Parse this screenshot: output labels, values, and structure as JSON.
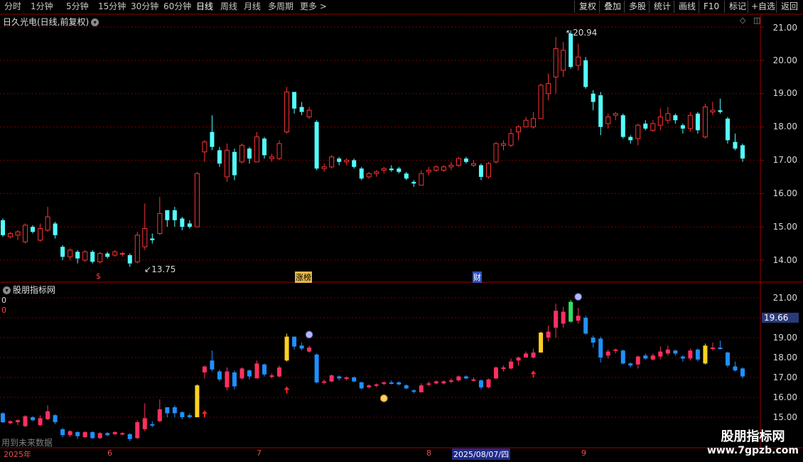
{
  "toolbar": {
    "periods": [
      "分时",
      "1分钟",
      "5分钟",
      "15分钟",
      "30分钟",
      "60分钟",
      "日线",
      "周线",
      "月线",
      "多周期",
      "更多 >"
    ],
    "active_period": "日线",
    "actions": [
      "复权",
      "叠加",
      "多股",
      "统计",
      "画线",
      "F10",
      "+自选",
      "返回"
    ],
    "mark_label": "标记"
  },
  "main_panel": {
    "title": "日久光电(日线,前复权)",
    "high_label": "20.94",
    "low_label": "13.75",
    "markers": [
      "$",
      "涨榜",
      "财"
    ],
    "y_ticks": [
      "21.00",
      "20.00",
      "19.00",
      "18.00",
      "17.00",
      "16.00",
      "15.00",
      "14.00"
    ]
  },
  "indicator_panel": {
    "title": "股朋指标网",
    "left_values": [
      "0",
      "0"
    ],
    "current_value": "19.66",
    "y_ticks": [
      "21.00",
      "19.00",
      "18.00",
      "17.00",
      "16.00",
      "15.00"
    ],
    "footer_note": "用到未来数据"
  },
  "time_axis": {
    "labels": [
      "2025年",
      "6",
      "7",
      "8",
      "9"
    ],
    "cursor_date": "2025/08/07/四"
  },
  "watermark": {
    "title": "股朋指标网",
    "url": "www.7gpzb.com"
  },
  "colors": {
    "up": "#ff3232",
    "down": "#54ffff",
    "bg": "#000000",
    "grid": "#7a0000"
  },
  "chart_data": {
    "type": "candlestick",
    "title": "日久光电(日线,前复权)",
    "ylim": [
      13.6,
      21.3
    ],
    "candles": [
      [
        15.2,
        14.75,
        15.25,
        14.7
      ],
      [
        14.7,
        14.8,
        14.85,
        14.65
      ],
      [
        14.75,
        14.85,
        14.9,
        14.6
      ],
      [
        14.55,
        15.05,
        15.1,
        14.5
      ],
      [
        15.0,
        14.85,
        15.05,
        14.8
      ],
      [
        14.6,
        14.95,
        15.1,
        14.55
      ],
      [
        14.9,
        15.3,
        15.6,
        14.85
      ],
      [
        15.1,
        14.75,
        15.15,
        14.65
      ],
      [
        14.4,
        14.1,
        14.45,
        14.0
      ],
      [
        14.1,
        14.3,
        14.35,
        14.0
      ],
      [
        14.25,
        14.05,
        14.3,
        13.9
      ],
      [
        14.0,
        14.25,
        14.3,
        13.95
      ],
      [
        14.25,
        13.95,
        14.3,
        13.9
      ],
      [
        13.95,
        14.2,
        14.25,
        13.9
      ],
      [
        14.2,
        14.1,
        14.25,
        14.05
      ],
      [
        14.15,
        14.25,
        14.3,
        14.1
      ],
      [
        14.2,
        14.2,
        14.25,
        14.1
      ],
      [
        14.15,
        13.9,
        14.2,
        13.8
      ],
      [
        13.95,
        14.75,
        14.85,
        13.9
      ],
      [
        14.4,
        14.95,
        15.7,
        14.3
      ],
      [
        14.65,
        14.6,
        14.8,
        14.5
      ],
      [
        14.8,
        15.4,
        15.9,
        14.75
      ],
      [
        15.5,
        15.2,
        15.5,
        15.0
      ],
      [
        15.5,
        15.2,
        15.6,
        15.0
      ],
      [
        15.25,
        15.0,
        15.3,
        14.9
      ],
      [
        15.1,
        15.0,
        15.2,
        14.95
      ],
      [
        15.0,
        16.6,
        16.65,
        15.0
      ],
      [
        17.25,
        17.55,
        17.6,
        16.95
      ],
      [
        17.85,
        17.4,
        18.35,
        17.3
      ],
      [
        17.3,
        16.9,
        17.4,
        16.8
      ],
      [
        16.5,
        17.3,
        17.5,
        16.35
      ],
      [
        17.25,
        16.55,
        17.35,
        16.4
      ],
      [
        16.95,
        17.45,
        17.5,
        16.9
      ],
      [
        17.35,
        17.05,
        17.4,
        16.9
      ],
      [
        16.95,
        17.7,
        17.85,
        16.95
      ],
      [
        17.65,
        17.15,
        17.7,
        17.05
      ],
      [
        17.05,
        17.1,
        17.2,
        16.95
      ],
      [
        17.05,
        17.5,
        17.6,
        17.0
      ],
      [
        17.85,
        19.05,
        19.2,
        17.8
      ],
      [
        19.05,
        18.55,
        19.05,
        18.4
      ],
      [
        18.6,
        18.45,
        18.75,
        18.35
      ],
      [
        18.3,
        18.5,
        18.6,
        18.25
      ],
      [
        18.15,
        16.75,
        18.2,
        16.7
      ],
      [
        16.75,
        16.8,
        16.9,
        16.65
      ],
      [
        16.8,
        17.1,
        17.15,
        16.75
      ],
      [
        17.05,
        16.95,
        17.1,
        16.85
      ],
      [
        16.95,
        17.0,
        17.05,
        16.85
      ],
      [
        17.0,
        16.8,
        17.05,
        16.75
      ],
      [
        16.75,
        16.45,
        16.8,
        16.4
      ],
      [
        16.5,
        16.6,
        16.65,
        16.45
      ],
      [
        16.6,
        16.65,
        16.7,
        16.5
      ],
      [
        16.7,
        16.75,
        16.8,
        16.6
      ],
      [
        16.75,
        16.7,
        16.85,
        16.65
      ],
      [
        16.75,
        16.65,
        16.8,
        16.6
      ],
      [
        16.6,
        16.45,
        16.65,
        16.4
      ],
      [
        16.35,
        16.3,
        16.4,
        16.2
      ],
      [
        16.25,
        16.6,
        16.7,
        16.25
      ],
      [
        16.65,
        16.7,
        16.8,
        16.55
      ],
      [
        16.7,
        16.8,
        16.85,
        16.65
      ],
      [
        16.7,
        16.8,
        16.85,
        16.65
      ],
      [
        16.8,
        16.85,
        16.95,
        16.7
      ],
      [
        16.85,
        17.05,
        17.1,
        16.8
      ],
      [
        17.05,
        16.95,
        17.1,
        16.9
      ],
      [
        16.85,
        16.9,
        17.0,
        16.8
      ],
      [
        16.85,
        16.5,
        16.9,
        16.4
      ],
      [
        16.5,
        16.9,
        16.95,
        16.45
      ],
      [
        16.95,
        17.5,
        17.55,
        16.9
      ],
      [
        17.45,
        17.5,
        17.6,
        17.3
      ],
      [
        17.45,
        17.8,
        17.95,
        17.4
      ],
      [
        17.85,
        18.0,
        18.05,
        17.6
      ],
      [
        18.0,
        18.2,
        18.3,
        18.0
      ],
      [
        18.0,
        18.25,
        18.45,
        17.95
      ],
      [
        18.25,
        19.25,
        19.3,
        18.25
      ],
      [
        19.0,
        19.3,
        19.6,
        18.8
      ],
      [
        19.5,
        20.35,
        20.7,
        19.0
      ],
      [
        19.7,
        20.3,
        20.55,
        19.5
      ],
      [
        20.8,
        19.8,
        20.9,
        19.75
      ],
      [
        19.85,
        20.1,
        20.5,
        19.7
      ],
      [
        20.0,
        19.2,
        20.1,
        19.15
      ],
      [
        19.0,
        18.75,
        19.1,
        18.5
      ],
      [
        18.95,
        18.0,
        19.05,
        17.75
      ],
      [
        18.1,
        18.3,
        18.4,
        17.95
      ],
      [
        18.35,
        18.4,
        18.45,
        18.2
      ],
      [
        18.35,
        17.7,
        18.4,
        17.65
      ],
      [
        17.7,
        17.6,
        17.75,
        17.5
      ],
      [
        17.65,
        18.05,
        18.1,
        17.45
      ],
      [
        18.1,
        17.95,
        18.2,
        17.9
      ],
      [
        17.9,
        18.1,
        18.2,
        17.85
      ],
      [
        18.05,
        18.3,
        18.55,
        17.9
      ],
      [
        18.2,
        18.4,
        18.6,
        18.1
      ],
      [
        18.35,
        18.2,
        18.4,
        18.1
      ],
      [
        18.05,
        17.95,
        18.1,
        17.8
      ],
      [
        17.95,
        18.35,
        18.45,
        17.85
      ],
      [
        18.4,
        17.9,
        18.45,
        17.8
      ],
      [
        17.7,
        18.6,
        18.7,
        17.65
      ],
      [
        18.45,
        18.5,
        18.75,
        18.35
      ],
      [
        18.5,
        18.45,
        18.85,
        18.4
      ],
      [
        18.25,
        17.6,
        18.3,
        17.5
      ],
      [
        17.55,
        17.35,
        17.8,
        17.3
      ],
      [
        17.45,
        17.05,
        17.5,
        16.95
      ]
    ]
  }
}
